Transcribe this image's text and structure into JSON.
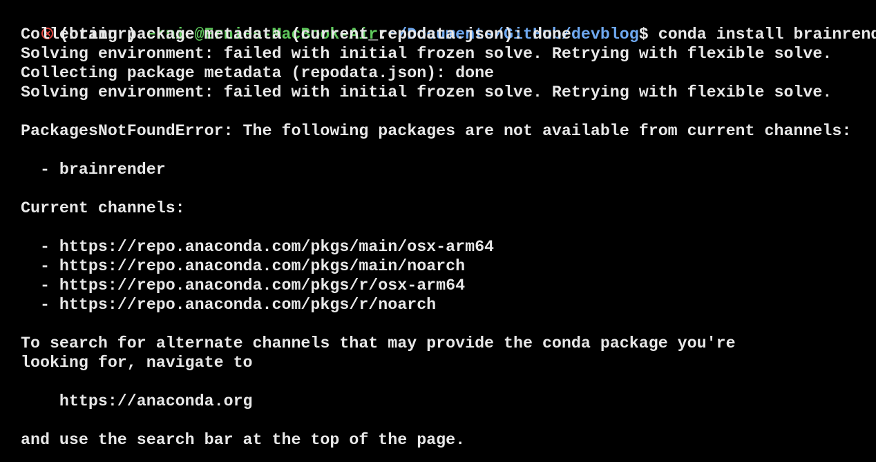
{
  "colors": {
    "background": "#000000",
    "text": "#e8e8e8",
    "user_host": "#5fc95c",
    "cwd": "#6ea8f0",
    "error_icon": "#e0443e"
  },
  "prompt": {
    "status_icon": "error-circle-x-icon",
    "env": "(brainr)",
    "user_host": "ernie@Ernies-MacBook-Air",
    "separator": ":",
    "cwd": "~/Documents/GitHub/devblog",
    "symbol": "$",
    "command": "conda install brainrender"
  },
  "output": {
    "line1": "Collecting package metadata (current_repodata.json): done",
    "line2": "Solving environment: failed with initial frozen solve. Retrying with flexible solve.",
    "line3": "Collecting package metadata (repodata.json): done",
    "line4": "Solving environment: failed with initial frozen solve. Retrying with flexible solve.",
    "error": "PackagesNotFoundError: The following packages are not available from current channels:",
    "missing_package": "  - brainrender",
    "channels_header": "Current channels:",
    "channels": [
      "  - https://repo.anaconda.com/pkgs/main/osx-arm64",
      "  - https://repo.anaconda.com/pkgs/main/noarch",
      "  - https://repo.anaconda.com/pkgs/r/osx-arm64",
      "  - https://repo.anaconda.com/pkgs/r/noarch"
    ],
    "search_line1": "To search for alternate channels that may provide the conda package you're",
    "search_line2": "looking for, navigate to",
    "url": "    https://anaconda.org",
    "final_line": "and use the search bar at the top of the page."
  }
}
